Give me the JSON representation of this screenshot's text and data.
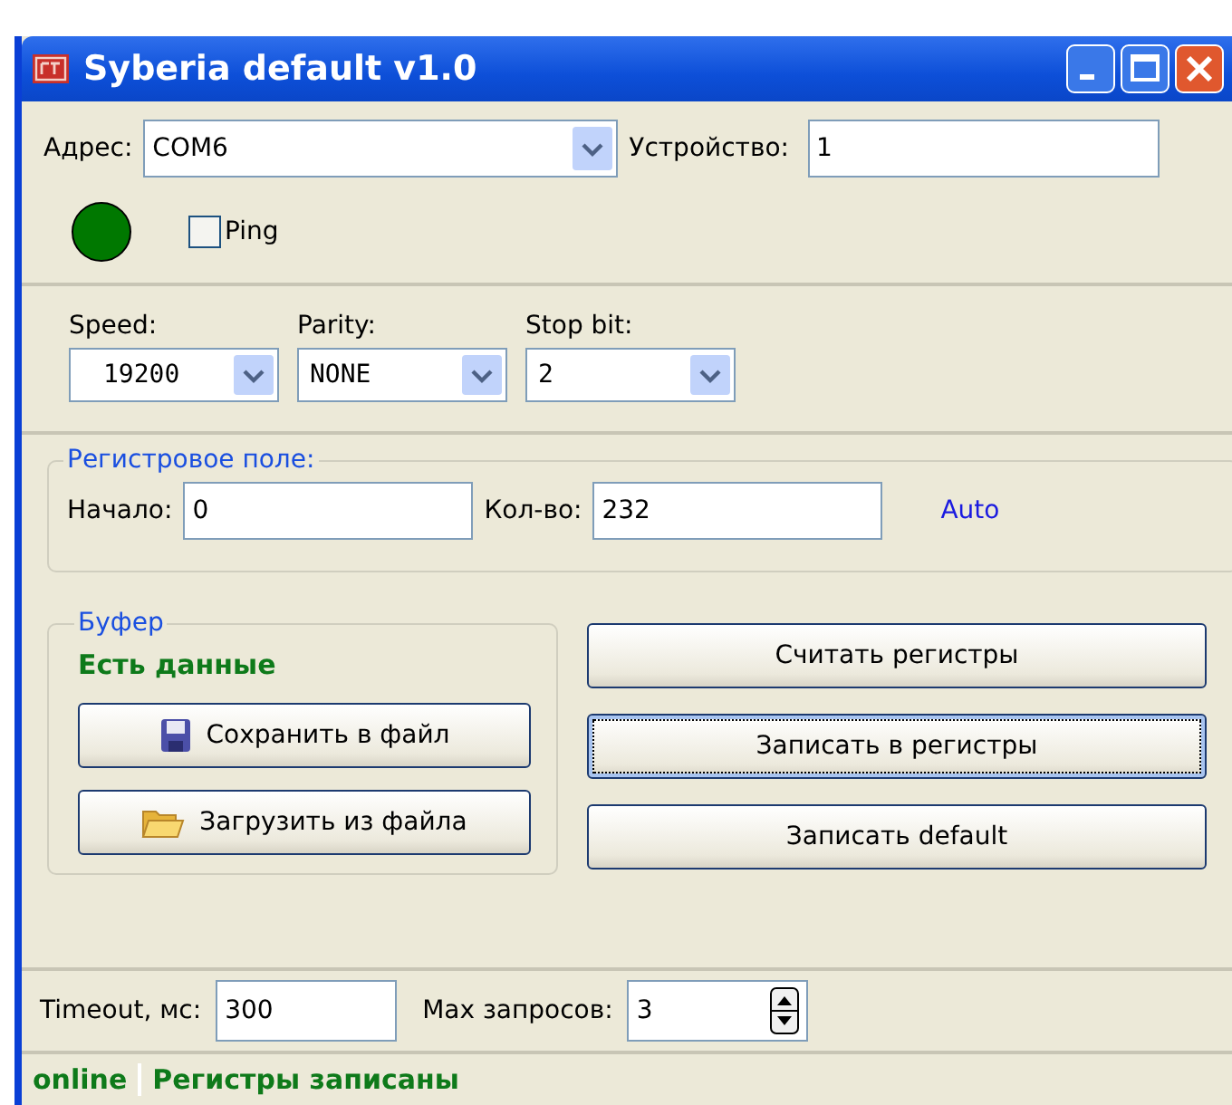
{
  "window": {
    "title": "Syberia default v1.0"
  },
  "connection": {
    "address_label": "Адрес:",
    "address": "COM6",
    "device_label": "Устройство:",
    "device": "1",
    "indicator_on": true,
    "ping": {
      "label": "Ping",
      "checked": false
    }
  },
  "port": [
    {
      "label": "Speed:",
      "value": "19200"
    },
    {
      "label": "Parity:",
      "value": "NONE"
    },
    {
      "label": "Stop bit:",
      "value": "2"
    }
  ],
  "register_field": {
    "title": "Регистровое поле:",
    "start_label": "Начало:",
    "start": "0",
    "count_label": "Кол-во:",
    "count": "232",
    "auto_link": "Auto"
  },
  "buffer": {
    "title": "Буфер",
    "status": "Есть данные",
    "buttons": [
      {
        "label": "Сохранить в файл",
        "kind": "save",
        "focused": false
      },
      {
        "label": "Загрузить из файла",
        "kind": "open",
        "focused": false
      }
    ]
  },
  "actions": [
    {
      "label": "Считать регистры",
      "focused": false
    },
    {
      "label": "Записать в регистры",
      "focused": true
    },
    {
      "label": "Записать default",
      "focused": false
    }
  ],
  "timeout": {
    "label": "Timeout, мс:",
    "value": "300",
    "max_label": "Max запросов:",
    "max_value": "3"
  },
  "status_bar": {
    "state": "online",
    "message": "Регистры записаны"
  }
}
